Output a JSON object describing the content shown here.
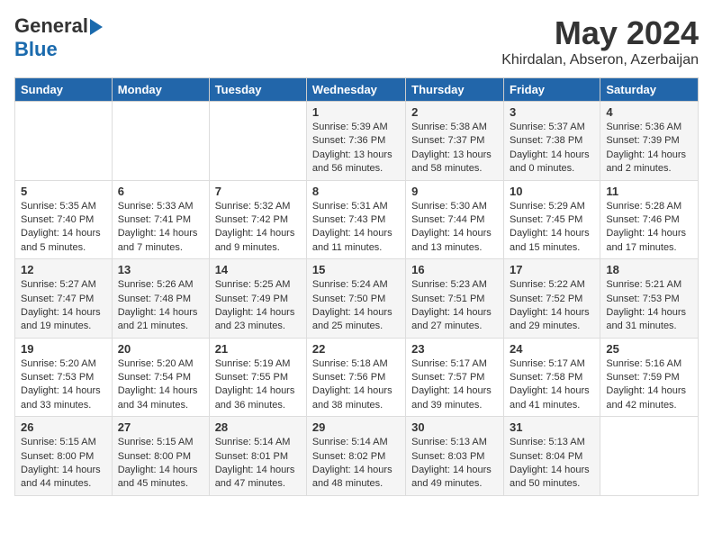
{
  "header": {
    "logo_general": "General",
    "logo_blue": "Blue",
    "month": "May 2024",
    "location": "Khirdalan, Abseron, Azerbaijan"
  },
  "weekdays": [
    "Sunday",
    "Monday",
    "Tuesday",
    "Wednesday",
    "Thursday",
    "Friday",
    "Saturday"
  ],
  "weeks": [
    [
      {
        "day": "",
        "text": ""
      },
      {
        "day": "",
        "text": ""
      },
      {
        "day": "",
        "text": ""
      },
      {
        "day": "1",
        "text": "Sunrise: 5:39 AM\nSunset: 7:36 PM\nDaylight: 13 hours and 56 minutes."
      },
      {
        "day": "2",
        "text": "Sunrise: 5:38 AM\nSunset: 7:37 PM\nDaylight: 13 hours and 58 minutes."
      },
      {
        "day": "3",
        "text": "Sunrise: 5:37 AM\nSunset: 7:38 PM\nDaylight: 14 hours and 0 minutes."
      },
      {
        "day": "4",
        "text": "Sunrise: 5:36 AM\nSunset: 7:39 PM\nDaylight: 14 hours and 2 minutes."
      }
    ],
    [
      {
        "day": "5",
        "text": "Sunrise: 5:35 AM\nSunset: 7:40 PM\nDaylight: 14 hours and 5 minutes."
      },
      {
        "day": "6",
        "text": "Sunrise: 5:33 AM\nSunset: 7:41 PM\nDaylight: 14 hours and 7 minutes."
      },
      {
        "day": "7",
        "text": "Sunrise: 5:32 AM\nSunset: 7:42 PM\nDaylight: 14 hours and 9 minutes."
      },
      {
        "day": "8",
        "text": "Sunrise: 5:31 AM\nSunset: 7:43 PM\nDaylight: 14 hours and 11 minutes."
      },
      {
        "day": "9",
        "text": "Sunrise: 5:30 AM\nSunset: 7:44 PM\nDaylight: 14 hours and 13 minutes."
      },
      {
        "day": "10",
        "text": "Sunrise: 5:29 AM\nSunset: 7:45 PM\nDaylight: 14 hours and 15 minutes."
      },
      {
        "day": "11",
        "text": "Sunrise: 5:28 AM\nSunset: 7:46 PM\nDaylight: 14 hours and 17 minutes."
      }
    ],
    [
      {
        "day": "12",
        "text": "Sunrise: 5:27 AM\nSunset: 7:47 PM\nDaylight: 14 hours and 19 minutes."
      },
      {
        "day": "13",
        "text": "Sunrise: 5:26 AM\nSunset: 7:48 PM\nDaylight: 14 hours and 21 minutes."
      },
      {
        "day": "14",
        "text": "Sunrise: 5:25 AM\nSunset: 7:49 PM\nDaylight: 14 hours and 23 minutes."
      },
      {
        "day": "15",
        "text": "Sunrise: 5:24 AM\nSunset: 7:50 PM\nDaylight: 14 hours and 25 minutes."
      },
      {
        "day": "16",
        "text": "Sunrise: 5:23 AM\nSunset: 7:51 PM\nDaylight: 14 hours and 27 minutes."
      },
      {
        "day": "17",
        "text": "Sunrise: 5:22 AM\nSunset: 7:52 PM\nDaylight: 14 hours and 29 minutes."
      },
      {
        "day": "18",
        "text": "Sunrise: 5:21 AM\nSunset: 7:53 PM\nDaylight: 14 hours and 31 minutes."
      }
    ],
    [
      {
        "day": "19",
        "text": "Sunrise: 5:20 AM\nSunset: 7:53 PM\nDaylight: 14 hours and 33 minutes."
      },
      {
        "day": "20",
        "text": "Sunrise: 5:20 AM\nSunset: 7:54 PM\nDaylight: 14 hours and 34 minutes."
      },
      {
        "day": "21",
        "text": "Sunrise: 5:19 AM\nSunset: 7:55 PM\nDaylight: 14 hours and 36 minutes."
      },
      {
        "day": "22",
        "text": "Sunrise: 5:18 AM\nSunset: 7:56 PM\nDaylight: 14 hours and 38 minutes."
      },
      {
        "day": "23",
        "text": "Sunrise: 5:17 AM\nSunset: 7:57 PM\nDaylight: 14 hours and 39 minutes."
      },
      {
        "day": "24",
        "text": "Sunrise: 5:17 AM\nSunset: 7:58 PM\nDaylight: 14 hours and 41 minutes."
      },
      {
        "day": "25",
        "text": "Sunrise: 5:16 AM\nSunset: 7:59 PM\nDaylight: 14 hours and 42 minutes."
      }
    ],
    [
      {
        "day": "26",
        "text": "Sunrise: 5:15 AM\nSunset: 8:00 PM\nDaylight: 14 hours and 44 minutes."
      },
      {
        "day": "27",
        "text": "Sunrise: 5:15 AM\nSunset: 8:00 PM\nDaylight: 14 hours and 45 minutes."
      },
      {
        "day": "28",
        "text": "Sunrise: 5:14 AM\nSunset: 8:01 PM\nDaylight: 14 hours and 47 minutes."
      },
      {
        "day": "29",
        "text": "Sunrise: 5:14 AM\nSunset: 8:02 PM\nDaylight: 14 hours and 48 minutes."
      },
      {
        "day": "30",
        "text": "Sunrise: 5:13 AM\nSunset: 8:03 PM\nDaylight: 14 hours and 49 minutes."
      },
      {
        "day": "31",
        "text": "Sunrise: 5:13 AM\nSunset: 8:04 PM\nDaylight: 14 hours and 50 minutes."
      },
      {
        "day": "",
        "text": ""
      }
    ]
  ]
}
